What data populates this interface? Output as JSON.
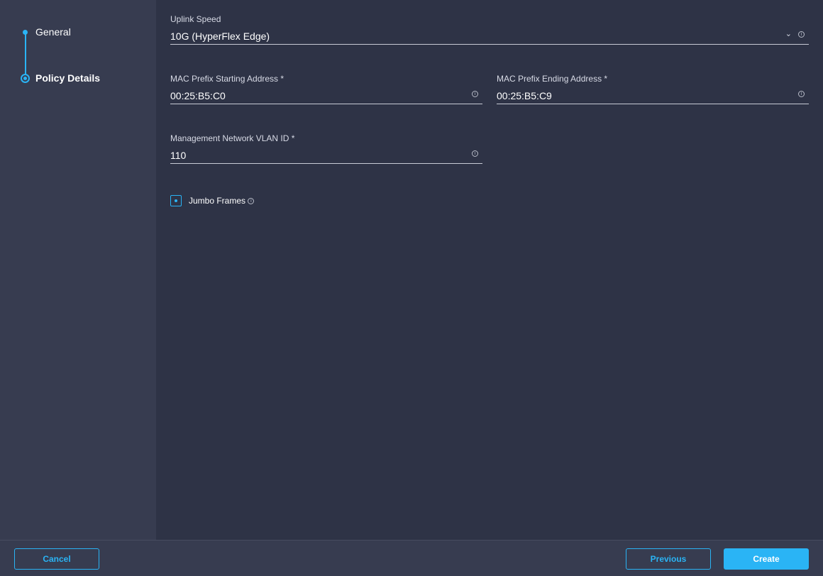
{
  "steps": [
    "General",
    "Policy Details"
  ],
  "uplink": {
    "label": "Uplink Speed",
    "value": "10G (HyperFlex Edge)"
  },
  "mac_start": {
    "label": "MAC Prefix Starting Address *",
    "value": "00:25:B5:C0"
  },
  "mac_end": {
    "label": "MAC Prefix Ending Address *",
    "value": "00:25:B5:C9"
  },
  "vlan": {
    "label": "Management Network VLAN ID *",
    "value": "110"
  },
  "jumbo": {
    "label": "Jumbo Frames",
    "checked": true
  },
  "footer": {
    "cancel": "Cancel",
    "previous": "Previous",
    "create": "Create"
  },
  "colors": {
    "accent": "#2ab4f5",
    "sidebar": "#373c50",
    "main": "#2e3346"
  }
}
